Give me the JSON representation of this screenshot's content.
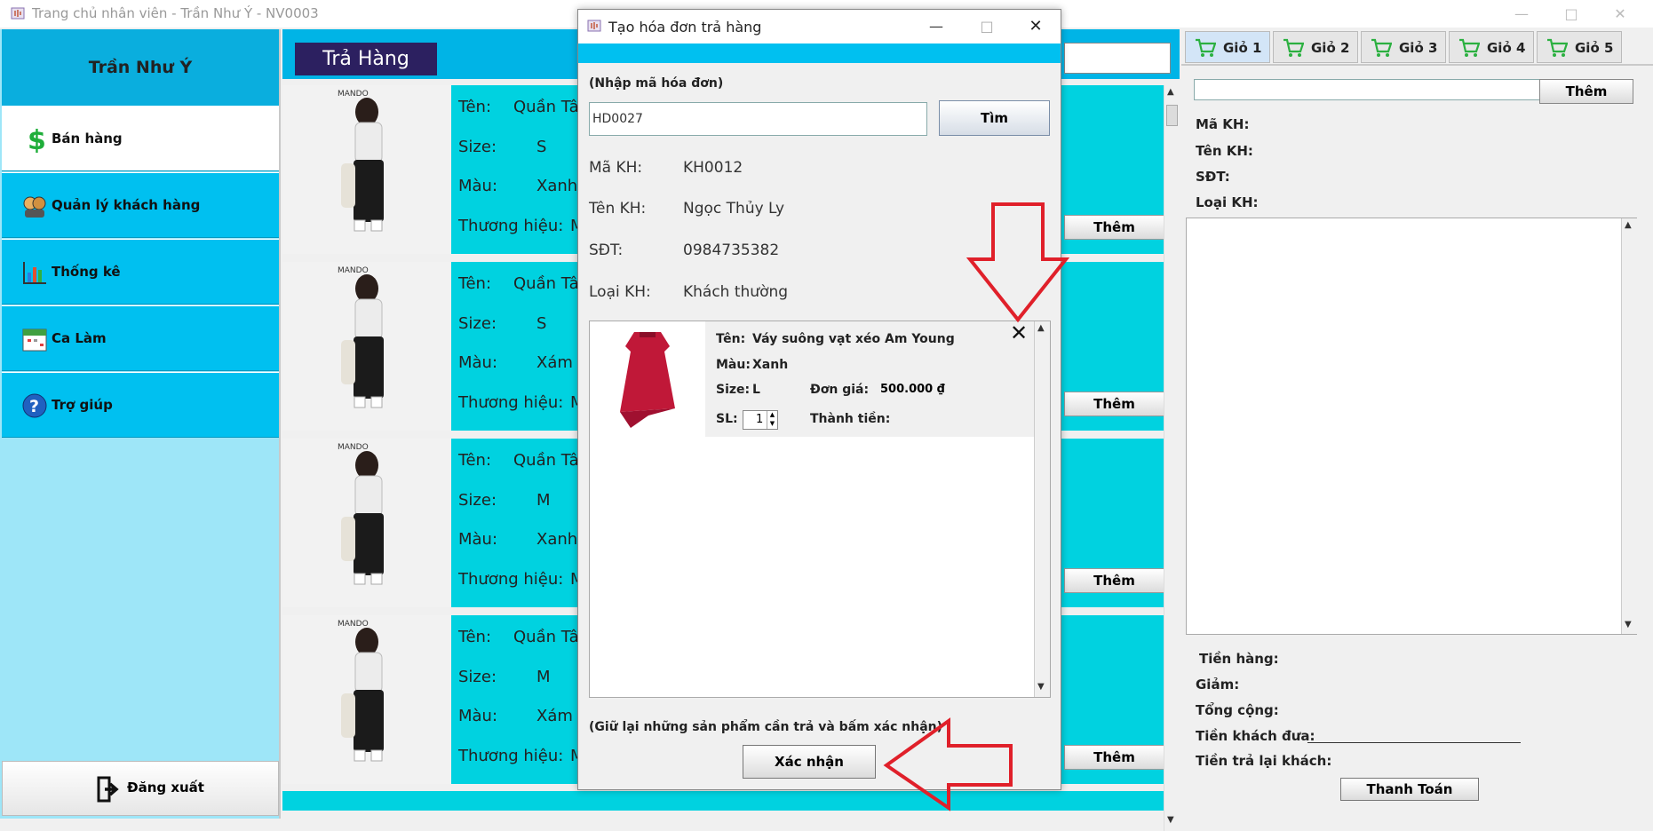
{
  "window": {
    "title": "Trang chủ nhân viên - Trần Như Ý - NV0003"
  },
  "sidebar": {
    "user_name": "Trần Như Ý",
    "items": [
      {
        "label": "Bán hàng",
        "icon": "dollar-icon"
      },
      {
        "label": "Quản lý khách hàng",
        "icon": "users-icon"
      },
      {
        "label": "Thống kê",
        "icon": "bar-chart-icon"
      },
      {
        "label": "Ca Làm",
        "icon": "calendar-icon"
      },
      {
        "label": "Trợ giúp",
        "icon": "help-icon"
      }
    ],
    "logout_label": "Đăng xuất"
  },
  "center": {
    "header_title": "Trả Hàng",
    "labels": {
      "name": "Tên:",
      "size": "Size:",
      "color": "Màu:",
      "brand": "Thương hiệu:"
    },
    "add_label": "Thêm",
    "products": [
      {
        "name": "Quần Tây",
        "size": "S",
        "color": "Xanh",
        "brand": "M"
      },
      {
        "name": "Quần Tây",
        "size": "S",
        "color": "Xám",
        "brand": "M"
      },
      {
        "name": "Quần Tây",
        "size": "M",
        "color": "Xanh",
        "brand": "M"
      },
      {
        "name": "Quần Tây",
        "size": "M",
        "color": "Xám",
        "brand": "M"
      }
    ]
  },
  "dialog": {
    "title": "Tạo hóa đơn trả hàng",
    "invoice_prompt": "(Nhập mã hóa đơn)",
    "invoice_value": "HD0027",
    "search_label": "Tìm",
    "customer": {
      "code_label": "Mã KH:",
      "code": "KH0012",
      "name_label": "Tên KH:",
      "name": "Ngọc Thủy Ly",
      "phone_label": "SĐT:",
      "phone": "0984735382",
      "type_label": "Loại KH:",
      "type": "Khách thường"
    },
    "item": {
      "name_label": "Tên:",
      "name": "Váy suông vạt xéo Am Young",
      "color_label": "Màu:",
      "color": "Xanh",
      "size_label": "Size:",
      "size": "L",
      "price_label": "Đơn giá:",
      "price": "500.000 ₫",
      "qty_label": "SL:",
      "qty": "1",
      "total_label": "Thành tiền:"
    },
    "hint": "(Giữ lại những sản phẩm cần trả và bấm xác nhận)",
    "confirm_label": "Xác nhận"
  },
  "right": {
    "tabs": [
      "Giỏ 1",
      "Giỏ 2",
      "Giỏ 3",
      "Giỏ 4",
      "Giỏ 5"
    ],
    "add_label": "Thêm",
    "customer_labels": [
      "Mã KH:",
      "Tên KH:",
      "SĐT:",
      "Loại KH:"
    ],
    "totals_labels": [
      "Tiền hàng:",
      "Giảm:",
      "Tổng cộng:",
      "Tiền khách đưa:",
      "Tiền trả lại khách:"
    ],
    "pay_label": "Thanh Toán"
  },
  "colors": {
    "accent": "#00c0f0",
    "header": "#2c2060",
    "annotation_arrow": "#e0202a"
  }
}
